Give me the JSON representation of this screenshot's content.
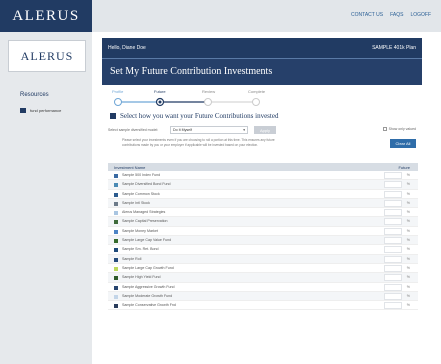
{
  "brand": {
    "logo_top": "ALERUS",
    "logo_side": "ALERUS"
  },
  "top_links": [
    "CONTACT US",
    "FAQS",
    "LOGOFF"
  ],
  "sidebar": {
    "resources_title": "Resources",
    "item_label": "fund performance"
  },
  "header": {
    "hello": "Hello, Diane Doe",
    "plan": "SAMPLE 401k Plan"
  },
  "page_title": "Set My Future Contribution Investments",
  "steps": [
    "Profile",
    "Future",
    "Review",
    "Complete"
  ],
  "section_title": "Select how you want your Future Contributions invested",
  "selector": {
    "label": "Select sample diversified model:",
    "value": "Do It Myself",
    "apply": "Apply",
    "show_only": "Show only valued"
  },
  "note": "Please select your investments even if you are choosing to roll a portion at this time. This ensures any future contributions made by you or your employer if applicable will be invested based on your election.",
  "clear_all": "Clear All",
  "table": {
    "col_name": "Investment Name",
    "col_future": "Future",
    "rows": [
      {
        "name": "Sample 500 Index Fund",
        "color": "#3a6aa3",
        "pct": "%"
      },
      {
        "name": "Sample Diversified Bond Fund",
        "color": "#4a8ab4",
        "pct": "%"
      },
      {
        "name": "Sample Common Stock",
        "color": "#2b5c8f",
        "pct": "%"
      },
      {
        "name": "Sample Intl Stock",
        "color": "#6d7b8a",
        "pct": "%"
      },
      {
        "name": "Alerus Managed Strategies",
        "color": "#a9c5e1",
        "pct": "%"
      },
      {
        "name": "Sample Capital Preservation",
        "color": "#3f6b3b",
        "pct": "%"
      },
      {
        "name": "Sample Money Market",
        "color": "#4d84c5",
        "pct": "%"
      },
      {
        "name": "Sample Large Cap Value Fund",
        "color": "#356b2c",
        "pct": "%"
      },
      {
        "name": "Sample Sm. Ret. Bond",
        "color": "#1f4a7a",
        "pct": "%"
      },
      {
        "name": "Sample Roll",
        "color": "#264c7c",
        "pct": "%"
      },
      {
        "name": "Sample Large Cap Growth Fund",
        "color": "#bcd95b",
        "pct": "%"
      },
      {
        "name": "Sample High Yield Fund",
        "color": "#2f5b2a",
        "pct": "%"
      },
      {
        "name": "Sample Aggressive Growth Fund",
        "color": "#27456f",
        "pct": "%"
      },
      {
        "name": "Sample Moderate Growth Fund",
        "color": "#c3d5e8",
        "pct": "%"
      },
      {
        "name": "Sample Conservative Growth Fnd",
        "color": "#2a3d5c",
        "pct": "%"
      }
    ]
  }
}
